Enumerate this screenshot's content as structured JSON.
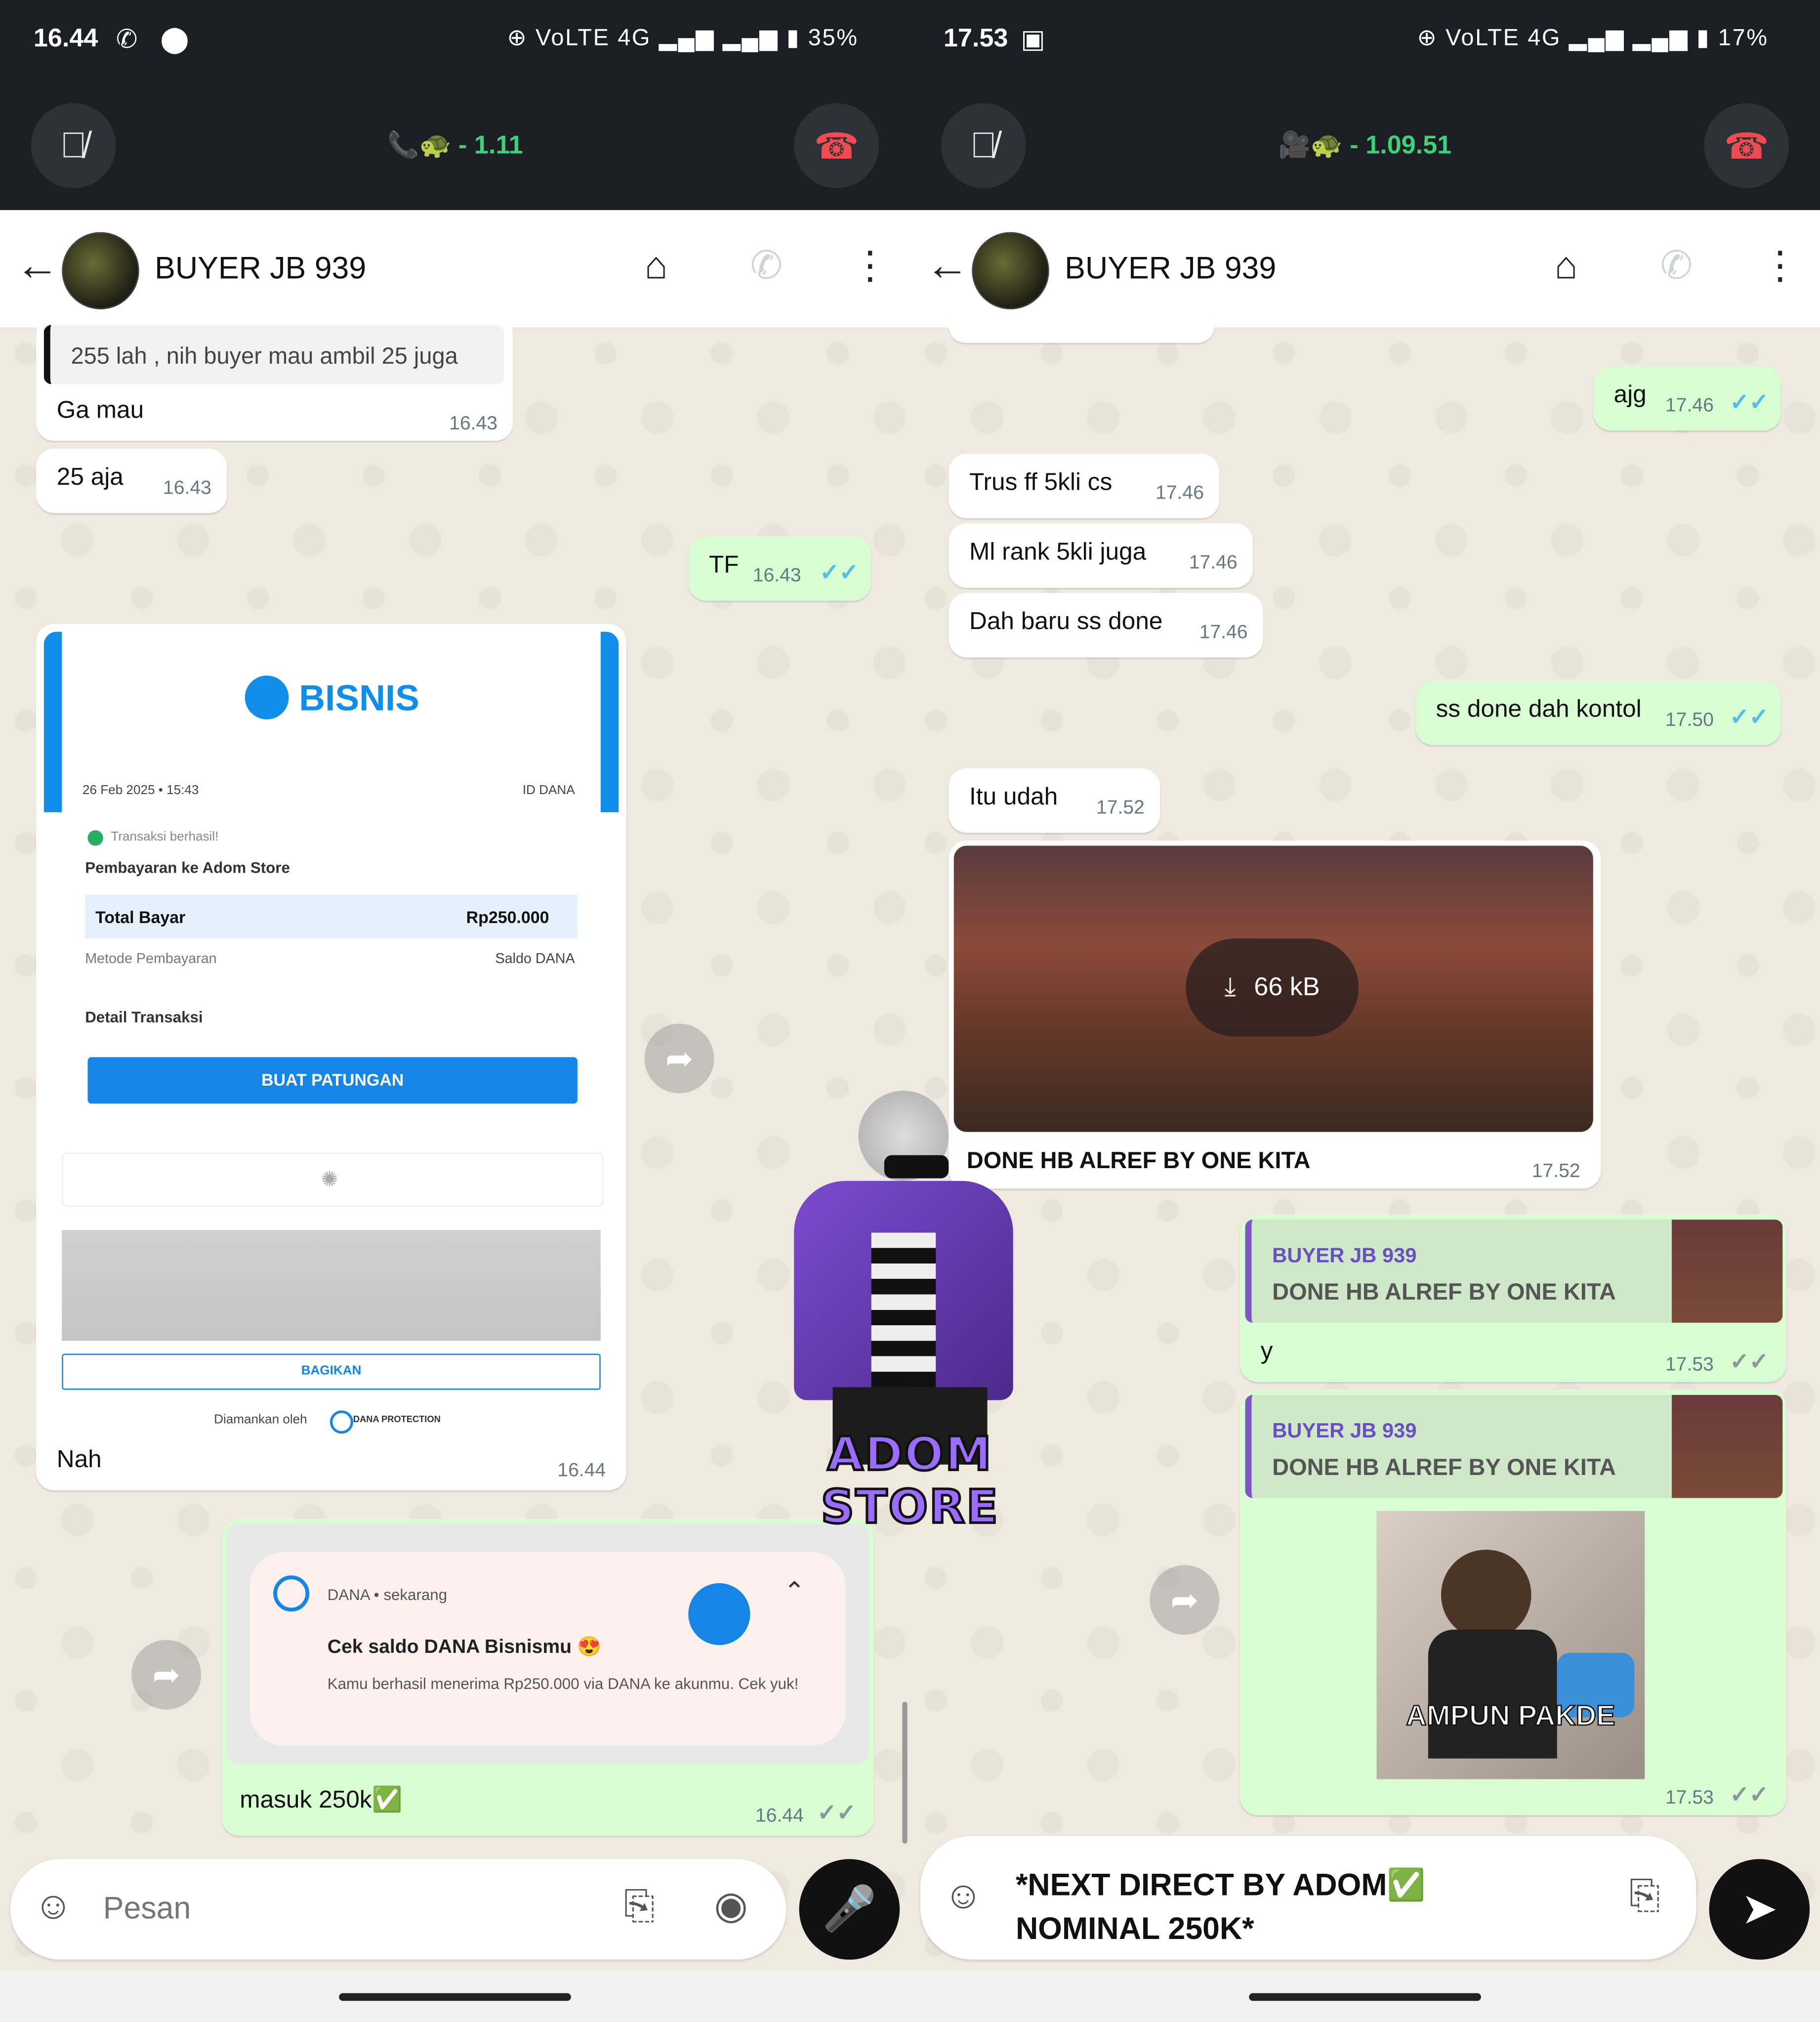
{
  "left": {
    "status": {
      "time": "16.44",
      "icons": "✆ ⬤",
      "sys": "⊕ VoLTE 4G ▂▄▆ ▂▄▆ ▮ 35%"
    },
    "call": {
      "timer": "📞🐢 - 1.11"
    },
    "header": {
      "title": "BUYER JB 939"
    },
    "messages": {
      "quote_text": "255 lah , nih buyer mau ambil 25 juga",
      "m1": {
        "text": "Ga mau",
        "time": "16.43"
      },
      "m2": {
        "text": "25 aja",
        "time": "16.43"
      },
      "m3": {
        "text": "TF",
        "time": "16.43",
        "tick": "✓✓"
      },
      "receipt": {
        "brand": "BISNIS",
        "date": "26 Feb 2025 • 15:43",
        "id_label": "ID DANA",
        "status": "Transaksi berhasil!",
        "payee": "Pembayaran ke Adom Store",
        "total_label": "Total Bayar",
        "total_value": "Rp250.000",
        "method_label": "Metode Pembayaran",
        "method_value": "Saldo DANA",
        "detail_label": "Detail Transaksi",
        "button": "BUAT PATUNGAN",
        "share": "BAGIKAN",
        "secured": "Diamankan oleh",
        "protection": "DANA PROTECTION"
      },
      "m4": {
        "text": "Nah",
        "time": "16.44"
      },
      "notif": {
        "app": "DANA • sekarang",
        "title": "Cek saldo DANA Bisnismu 😍",
        "body": "Kamu berhasil menerima Rp250.000 via DANA ke akunmu. Cek yuk!"
      },
      "m5": {
        "text": "masuk 250k✅",
        "time": "16.44",
        "tick": "✓✓"
      }
    },
    "input": {
      "placeholder": "Pesan"
    }
  },
  "right": {
    "status": {
      "time": "17.53",
      "icons": "▣",
      "sys": "⊕ VoLTE 4G ▂▄▆ ▂▄▆ ▮ 17%"
    },
    "call": {
      "timer": "🎥🐢 - 1.09.51"
    },
    "header": {
      "title": "BUYER JB 939"
    },
    "messages": {
      "r1": {
        "text": "ajg",
        "time": "17.46",
        "tick": "✓✓"
      },
      "r2": {
        "text": "Trus ff 5kli cs",
        "time": "17.46"
      },
      "r3": {
        "text": "Ml rank 5kli juga",
        "time": "17.46"
      },
      "r4": {
        "text": "Dah baru ss done",
        "time": "17.46"
      },
      "r5": {
        "text": "ss done dah kontol",
        "time": "17.50",
        "tick": "✓✓"
      },
      "r6": {
        "text": "Itu udah",
        "time": "17.52"
      },
      "media": {
        "size": "66 kB",
        "caption": "DONE HB ALREF BY ONE KITA",
        "time": "17.52"
      },
      "reply1": {
        "name": "BUYER JB 939",
        "quoted": "DONE HB ALREF BY ONE KITA",
        "text": "y",
        "time": "17.53",
        "tick": "✓✓"
      },
      "reply2": {
        "name": "BUYER JB 939",
        "quoted": "DONE HB ALREF BY ONE KITA",
        "sticker_text": "AMPUN PAKDE",
        "time": "17.53",
        "tick": "✓✓"
      }
    },
    "input": {
      "line1": "*NEXT DIRECT BY ADOM✅",
      "line2": "NOMINAL 250K*"
    }
  },
  "sticker": {
    "text": "ADOM STORE"
  }
}
